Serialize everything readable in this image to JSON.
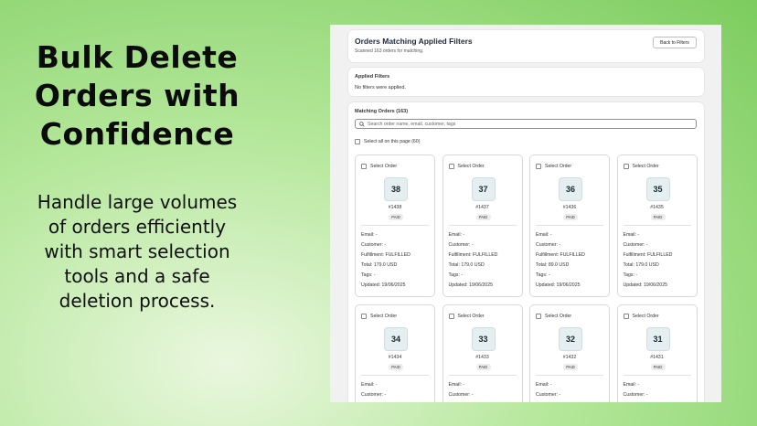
{
  "promo": {
    "headline": [
      "Bulk Delete",
      "Orders with",
      "Confidence"
    ],
    "subtext": [
      "Handle large volumes",
      "of orders efficiently",
      "with smart selection",
      "tools and a safe",
      "deletion process."
    ]
  },
  "header": {
    "title": "Orders Matching Applied Filters",
    "subtitle": "Scanned 163 orders for matching.",
    "back_label": "Back to Filters"
  },
  "filters": {
    "title": "Applied Filters",
    "text": "No filters were applied."
  },
  "matching": {
    "title": "Matching Orders (163)",
    "search_placeholder": "Search order name, email, customer, tags",
    "select_all_label": "Select all on this page (60)"
  },
  "order_labels": {
    "select": "Select Order",
    "email": "Email: -",
    "customer": "Customer: -",
    "fulfillment": "Fulfillment: FULFILLED",
    "tags": "Tags: -",
    "updated": "Updated: 19/06/2025"
  },
  "orders": [
    {
      "qty": "38",
      "number": "#1438",
      "status": "PAID",
      "total": "Total: 179.0 USD"
    },
    {
      "qty": "37",
      "number": "#1437",
      "status": "PAID",
      "total": "Total: 179.0 USD"
    },
    {
      "qty": "36",
      "number": "#1436",
      "status": "PAID",
      "total": "Total: 89.0 USD"
    },
    {
      "qty": "35",
      "number": "#1435",
      "status": "PAID",
      "total": "Total: 179.0 USD"
    },
    {
      "qty": "34",
      "number": "#1434",
      "status": "PAID"
    },
    {
      "qty": "33",
      "number": "#1433",
      "status": "PAID"
    },
    {
      "qty": "32",
      "number": "#1432",
      "status": "PAID"
    },
    {
      "qty": "31",
      "number": "#1431",
      "status": "PAID"
    }
  ],
  "icons": {
    "search": "search-icon",
    "checkbox": "checkbox-icon"
  }
}
